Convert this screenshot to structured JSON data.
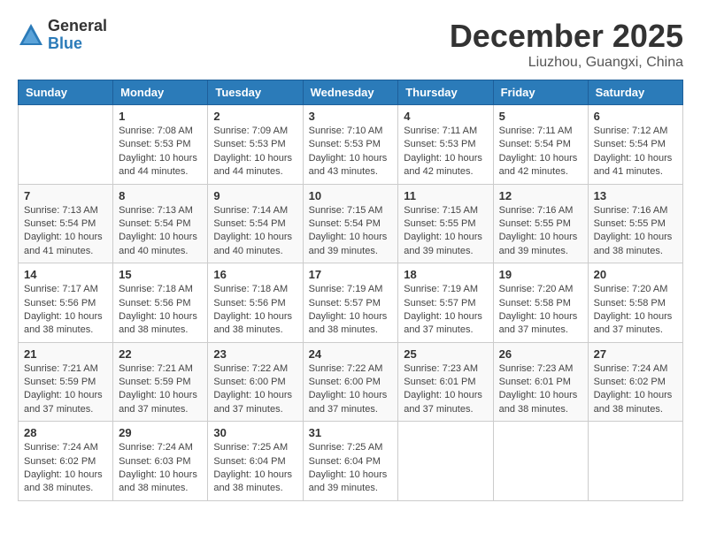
{
  "header": {
    "logo_general": "General",
    "logo_blue": "Blue",
    "month_title": "December 2025",
    "location": "Liuzhou, Guangxi, China"
  },
  "weekdays": [
    "Sunday",
    "Monday",
    "Tuesday",
    "Wednesday",
    "Thursday",
    "Friday",
    "Saturday"
  ],
  "weeks": [
    [
      {
        "day": "",
        "info": ""
      },
      {
        "day": "1",
        "info": "Sunrise: 7:08 AM\nSunset: 5:53 PM\nDaylight: 10 hours and 44 minutes."
      },
      {
        "day": "2",
        "info": "Sunrise: 7:09 AM\nSunset: 5:53 PM\nDaylight: 10 hours and 44 minutes."
      },
      {
        "day": "3",
        "info": "Sunrise: 7:10 AM\nSunset: 5:53 PM\nDaylight: 10 hours and 43 minutes."
      },
      {
        "day": "4",
        "info": "Sunrise: 7:11 AM\nSunset: 5:53 PM\nDaylight: 10 hours and 42 minutes."
      },
      {
        "day": "5",
        "info": "Sunrise: 7:11 AM\nSunset: 5:54 PM\nDaylight: 10 hours and 42 minutes."
      },
      {
        "day": "6",
        "info": "Sunrise: 7:12 AM\nSunset: 5:54 PM\nDaylight: 10 hours and 41 minutes."
      }
    ],
    [
      {
        "day": "7",
        "info": "Sunrise: 7:13 AM\nSunset: 5:54 PM\nDaylight: 10 hours and 41 minutes."
      },
      {
        "day": "8",
        "info": "Sunrise: 7:13 AM\nSunset: 5:54 PM\nDaylight: 10 hours and 40 minutes."
      },
      {
        "day": "9",
        "info": "Sunrise: 7:14 AM\nSunset: 5:54 PM\nDaylight: 10 hours and 40 minutes."
      },
      {
        "day": "10",
        "info": "Sunrise: 7:15 AM\nSunset: 5:54 PM\nDaylight: 10 hours and 39 minutes."
      },
      {
        "day": "11",
        "info": "Sunrise: 7:15 AM\nSunset: 5:55 PM\nDaylight: 10 hours and 39 minutes."
      },
      {
        "day": "12",
        "info": "Sunrise: 7:16 AM\nSunset: 5:55 PM\nDaylight: 10 hours and 39 minutes."
      },
      {
        "day": "13",
        "info": "Sunrise: 7:16 AM\nSunset: 5:55 PM\nDaylight: 10 hours and 38 minutes."
      }
    ],
    [
      {
        "day": "14",
        "info": "Sunrise: 7:17 AM\nSunset: 5:56 PM\nDaylight: 10 hours and 38 minutes."
      },
      {
        "day": "15",
        "info": "Sunrise: 7:18 AM\nSunset: 5:56 PM\nDaylight: 10 hours and 38 minutes."
      },
      {
        "day": "16",
        "info": "Sunrise: 7:18 AM\nSunset: 5:56 PM\nDaylight: 10 hours and 38 minutes."
      },
      {
        "day": "17",
        "info": "Sunrise: 7:19 AM\nSunset: 5:57 PM\nDaylight: 10 hours and 38 minutes."
      },
      {
        "day": "18",
        "info": "Sunrise: 7:19 AM\nSunset: 5:57 PM\nDaylight: 10 hours and 37 minutes."
      },
      {
        "day": "19",
        "info": "Sunrise: 7:20 AM\nSunset: 5:58 PM\nDaylight: 10 hours and 37 minutes."
      },
      {
        "day": "20",
        "info": "Sunrise: 7:20 AM\nSunset: 5:58 PM\nDaylight: 10 hours and 37 minutes."
      }
    ],
    [
      {
        "day": "21",
        "info": "Sunrise: 7:21 AM\nSunset: 5:59 PM\nDaylight: 10 hours and 37 minutes."
      },
      {
        "day": "22",
        "info": "Sunrise: 7:21 AM\nSunset: 5:59 PM\nDaylight: 10 hours and 37 minutes."
      },
      {
        "day": "23",
        "info": "Sunrise: 7:22 AM\nSunset: 6:00 PM\nDaylight: 10 hours and 37 minutes."
      },
      {
        "day": "24",
        "info": "Sunrise: 7:22 AM\nSunset: 6:00 PM\nDaylight: 10 hours and 37 minutes."
      },
      {
        "day": "25",
        "info": "Sunrise: 7:23 AM\nSunset: 6:01 PM\nDaylight: 10 hours and 37 minutes."
      },
      {
        "day": "26",
        "info": "Sunrise: 7:23 AM\nSunset: 6:01 PM\nDaylight: 10 hours and 38 minutes."
      },
      {
        "day": "27",
        "info": "Sunrise: 7:24 AM\nSunset: 6:02 PM\nDaylight: 10 hours and 38 minutes."
      }
    ],
    [
      {
        "day": "28",
        "info": "Sunrise: 7:24 AM\nSunset: 6:02 PM\nDaylight: 10 hours and 38 minutes."
      },
      {
        "day": "29",
        "info": "Sunrise: 7:24 AM\nSunset: 6:03 PM\nDaylight: 10 hours and 38 minutes."
      },
      {
        "day": "30",
        "info": "Sunrise: 7:25 AM\nSunset: 6:04 PM\nDaylight: 10 hours and 38 minutes."
      },
      {
        "day": "31",
        "info": "Sunrise: 7:25 AM\nSunset: 6:04 PM\nDaylight: 10 hours and 39 minutes."
      },
      {
        "day": "",
        "info": ""
      },
      {
        "day": "",
        "info": ""
      },
      {
        "day": "",
        "info": ""
      }
    ]
  ]
}
